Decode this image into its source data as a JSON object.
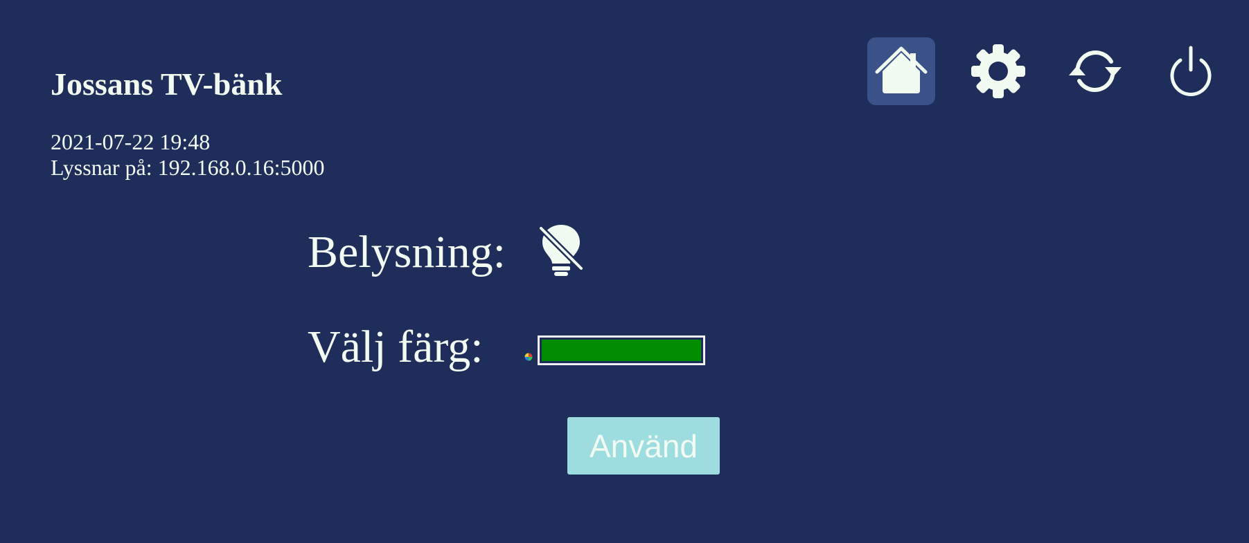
{
  "header": {
    "title": "Jossans TV-bänk",
    "datetime": "2021-07-22 19:48",
    "listening": "Lyssnar på: 192.168.0.16:5000"
  },
  "nav": {
    "items": [
      {
        "icon": "home-icon",
        "active": true
      },
      {
        "icon": "gear-icon",
        "active": false
      },
      {
        "icon": "refresh-icon",
        "active": false
      },
      {
        "icon": "power-icon",
        "active": false
      }
    ]
  },
  "controls": {
    "lighting_label": "Belysning:",
    "lighting_state": "off",
    "lighting_icon": "lightbulb-off-icon",
    "color_label": "Välj färg:",
    "color_value": "#008c00",
    "apply_label": "Använd"
  },
  "colors": {
    "background": "#1e2d59",
    "active_nav": "#3a5288",
    "text": "#f2fbf1",
    "apply_button": "#9ddcdf"
  }
}
